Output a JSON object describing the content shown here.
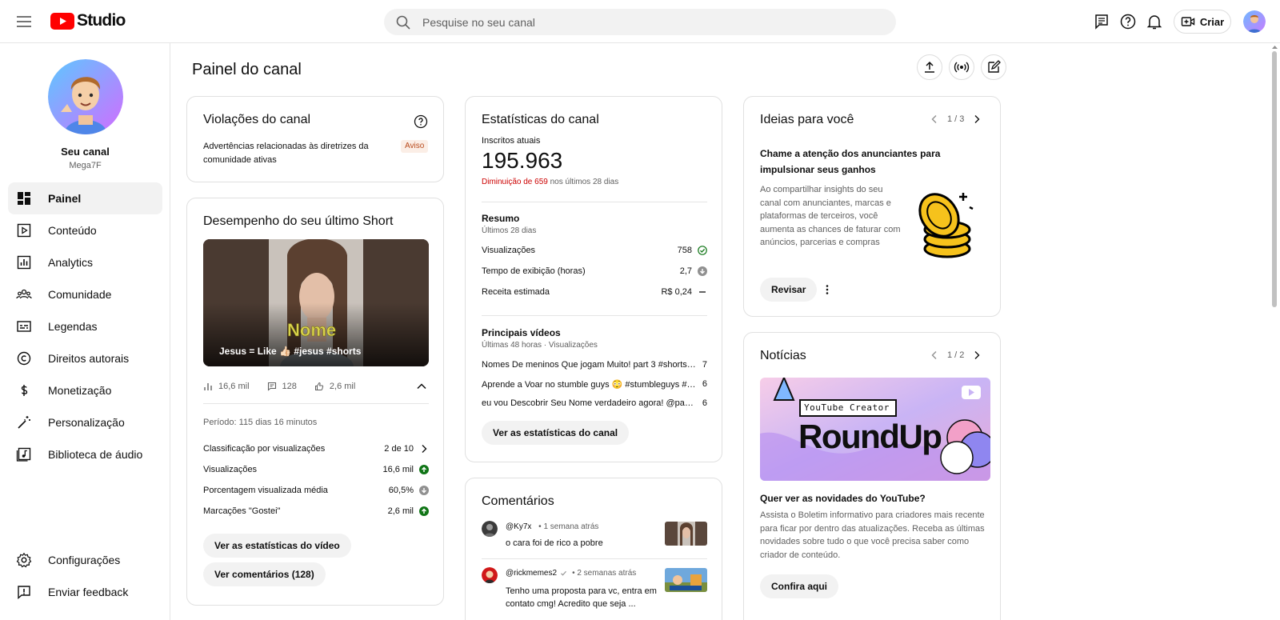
{
  "app": {
    "logo_text": "Studio",
    "brand_color": "#ff0000"
  },
  "search": {
    "placeholder": "Pesquise no seu canal"
  },
  "topbar": {
    "create_label": "Criar"
  },
  "sidebar": {
    "channel_name": "Seu canal",
    "channel_handle": "Mega7F",
    "items": [
      {
        "label": "Painel",
        "icon": "dashboard-icon",
        "active": true
      },
      {
        "label": "Conteúdo",
        "icon": "content-icon"
      },
      {
        "label": "Analytics",
        "icon": "analytics-icon"
      },
      {
        "label": "Comunidade",
        "icon": "community-icon"
      },
      {
        "label": "Legendas",
        "icon": "subtitles-icon"
      },
      {
        "label": "Direitos autorais",
        "icon": "copyright-icon"
      },
      {
        "label": "Monetização",
        "icon": "monetization-icon"
      },
      {
        "label": "Personalização",
        "icon": "customization-icon"
      },
      {
        "label": "Biblioteca de áudio",
        "icon": "audio-library-icon"
      }
    ],
    "bottom_items": [
      {
        "label": "Configurações",
        "icon": "settings-icon"
      },
      {
        "label": "Enviar feedback",
        "icon": "feedback-icon"
      }
    ]
  },
  "main": {
    "title": "Painel do canal"
  },
  "violations": {
    "title": "Violações do canal",
    "description": "Advertências relacionadas às diretrizes da comunidade ativas",
    "badge": "Aviso"
  },
  "short": {
    "title": "Desempenho do seu último Short",
    "video_title": "Jesus = Like 👍🏻 #jesus #shorts",
    "overlay_text": "Nome",
    "views": "16,6 mil",
    "comments": "128",
    "likes": "2,6 mil",
    "period": "Período: 115 dias 16 minutos",
    "rows": [
      {
        "label": "Classificação por visualizações",
        "value": "2 de 10",
        "indicator": "chevron-right-icon"
      },
      {
        "label": "Visualizações",
        "value": "16,6 mil",
        "indicator": "arrow-up-icon"
      },
      {
        "label": "Porcentagem visualizada média",
        "value": "60,5%",
        "indicator": "arrow-down-icon"
      },
      {
        "label": "Marcações \"Gostei\"",
        "value": "2,6 mil",
        "indicator": "arrow-up-icon"
      }
    ],
    "btn_stats": "Ver as estatísticas do vídeo",
    "btn_comments": "Ver comentários (128)"
  },
  "stats": {
    "title": "Estatísticas do canal",
    "subs_label": "Inscritos atuais",
    "subs_value": "195.963",
    "subs_change": "Diminuição de 659",
    "subs_change_suffix": "nos últimos 28 dias",
    "summary_title": "Resumo",
    "summary_sub": "Últimos 28 dias",
    "summary_rows": [
      {
        "label": "Visualizações",
        "value": "758",
        "indicator": "check-circle-icon"
      },
      {
        "label": "Tempo de exibição (horas)",
        "value": "2,7",
        "indicator": "arrow-down-icon"
      },
      {
        "label": "Receita estimada",
        "value": "R$ 0,24",
        "indicator": "dash-icon"
      }
    ],
    "top_title": "Principais vídeos",
    "top_sub": "Últimas 48 horas · Visualizações",
    "top_rows": [
      {
        "label": "Nomes De meninos Que jogam Muito! part 3 #shorts #...",
        "value": "7"
      },
      {
        "label": "Aprende a Voar no stumble guys 😳 #stumbleguys #sh...",
        "value": "6"
      },
      {
        "label": "eu vou Descobrir Seu Nome verdadeiro agora! @paponi...",
        "value": "6"
      }
    ],
    "btn": "Ver as estatísticas do canal"
  },
  "comments": {
    "title": "Comentários",
    "items": [
      {
        "author": "@Ky7x",
        "time": "• 1 semana atrás",
        "text": "o cara foi de rico a pobre"
      },
      {
        "author": "@rickmemes2",
        "time": "• 2 semanas atrás",
        "text": "Tenho uma proposta para vc, entra em contato cmg! Acredito que seja ..."
      }
    ]
  },
  "ideas": {
    "title": "Ideias para você",
    "pager": "1 / 3",
    "headline": "Chame a atenção dos anunciantes para impulsionar seus ganhos",
    "body": "Ao compartilhar insights do seu canal com anunciantes, marcas e plataformas de terceiros, você aumenta as chances de faturar com anúncios, parcerias e compras",
    "btn": "Revisar"
  },
  "news": {
    "title": "Notícias",
    "pager": "1 / 2",
    "banner_label": "YouTube Creator",
    "banner_title": "RoundUp",
    "headline": "Quer ver as novidades do YouTube?",
    "body": "Assista o Boletim informativo para criadores mais recente para ficar por dentro das atualizações. Receba as últimas novidades sobre tudo o que você precisa saber como criador de conteúdo.",
    "btn": "Confira aqui"
  }
}
